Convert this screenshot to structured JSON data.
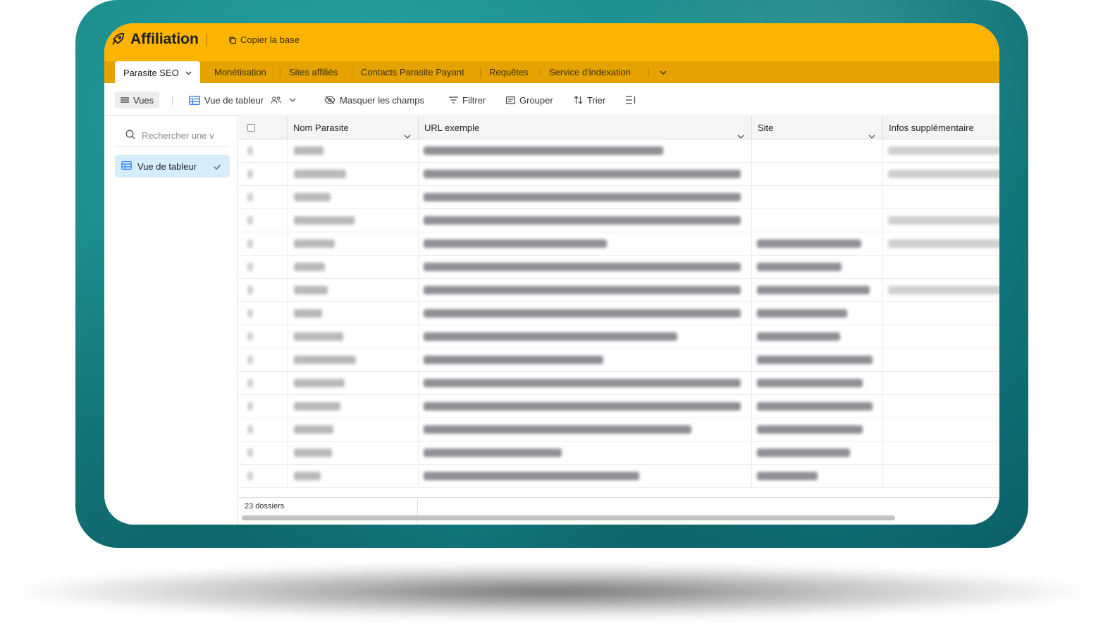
{
  "app": {
    "title": "Affiliation",
    "copy_base": "Copier la base"
  },
  "tabs": [
    "Parasite SEO",
    "Monétisation",
    "Sites affiliés",
    "Contacts Parasite Payant",
    "Requêtes",
    "Service d'indexation"
  ],
  "toolbar": {
    "views": "Vues",
    "grid_view": "Vue de tableur",
    "hide_fields": "Masquer les champs",
    "filter": "Filtrer",
    "group": "Grouper",
    "sort": "Trier"
  },
  "sidebar": {
    "search_placeholder": "Rechercher une v",
    "views": [
      {
        "label": "Vue de tableur",
        "selected": true
      }
    ]
  },
  "grid": {
    "columns": [
      "Nom Parasite",
      "URL exemple",
      "Site",
      "Infos supplémentaire"
    ],
    "row_count": 15,
    "rows_content": "blurred",
    "footer": "23 dossiers"
  },
  "colors": {
    "frame_teal": "#1a8c8c",
    "topbar": "#fcb400",
    "tabbar": "#e5a200",
    "selected_view": "#d6eefb"
  },
  "icons": [
    "rocket-icon",
    "copy-icon",
    "chevron-down-icon",
    "menu-icon",
    "grid-icon",
    "people-icon",
    "eye-off-icon",
    "filter-icon",
    "group-icon",
    "sort-icon",
    "row-height-icon",
    "search-icon",
    "check-icon"
  ]
}
